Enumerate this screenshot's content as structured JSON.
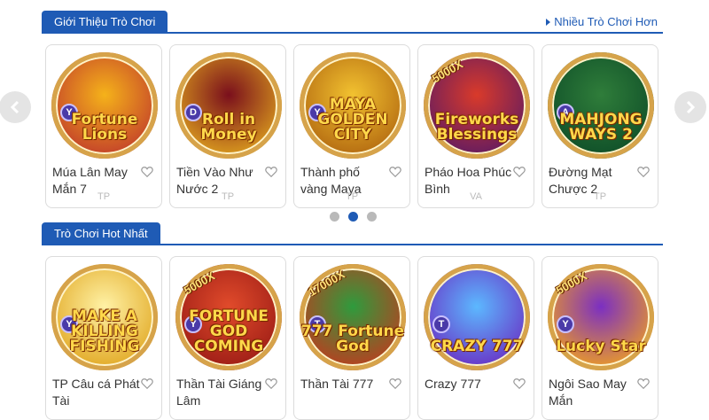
{
  "intro_section": {
    "title": "Giới Thiệu Trò Chơi",
    "more_label": "Nhiều Trò Chơi Hơn",
    "games": [
      {
        "name": "Múa Lân May Mắn 7",
        "provider": "TP",
        "art_text": "Fortune Lions",
        "badge": "Y",
        "multiplier": "",
        "colors": [
          "#f5b21a",
          "#c0392b"
        ]
      },
      {
        "name": "Tiền Vào Như Nước 2",
        "provider": "TP",
        "art_text": "Roll in Money",
        "badge": "D",
        "multiplier": "",
        "colors": [
          "#7a0f1c",
          "#e0a51e"
        ]
      },
      {
        "name": "Thành phố vàng Maya",
        "provider": "TP",
        "art_text": "MAYA GOLDEN CITY",
        "badge": "Y",
        "multiplier": "",
        "colors": [
          "#f2c230",
          "#b0650f"
        ]
      },
      {
        "name": "Pháo Hoa Phúc Bình",
        "provider": "VA",
        "art_text": "Fireworks Blessings",
        "badge": "",
        "multiplier": "5000X",
        "colors": [
          "#d93a2a",
          "#5c1a63"
        ]
      },
      {
        "name": "Đường Mạt Chược 2",
        "provider": "TP",
        "art_text": "MAHJONG WAYS 2",
        "badge": "A",
        "multiplier": "",
        "colors": [
          "#2f7d3a",
          "#0e4d28"
        ]
      }
    ]
  },
  "carousel": {
    "dots": 3,
    "active_dot": 1
  },
  "hot_section": {
    "title": "Trò Chơi Hot Nhất",
    "games": [
      {
        "name": "TP Câu cá Phát Tài",
        "provider": "",
        "art_text": "MAKE A KILLING FISHING",
        "badge": "Y",
        "multiplier": "",
        "colors": [
          "#fff2a6",
          "#e0a51e"
        ]
      },
      {
        "name": "Thần Tài Giáng Lâm",
        "provider": "",
        "art_text": "FORTUNE GOD COMING",
        "badge": "Y",
        "multiplier": "5000X",
        "colors": [
          "#e14b2b",
          "#9a1b15"
        ]
      },
      {
        "name": "Thần Tài 777",
        "provider": "",
        "art_text": "777 Fortune God",
        "badge": "T",
        "multiplier": "17000X",
        "colors": [
          "#2e9b3d",
          "#c23a1e"
        ]
      },
      {
        "name": "Crazy 777",
        "provider": "",
        "art_text": "CRAZY 777",
        "badge": "T",
        "multiplier": "",
        "colors": [
          "#5cb8ff",
          "#6a2bc2"
        ]
      },
      {
        "name": "Ngôi Sao May Mắn",
        "provider": "",
        "art_text": "Lucky Star",
        "badge": "Y",
        "multiplier": "5000X",
        "colors": [
          "#7b2fc2",
          "#f0a020"
        ]
      }
    ]
  },
  "nav": {
    "prev_icon": "chevron-left-icon",
    "next_icon": "chevron-right-icon"
  }
}
